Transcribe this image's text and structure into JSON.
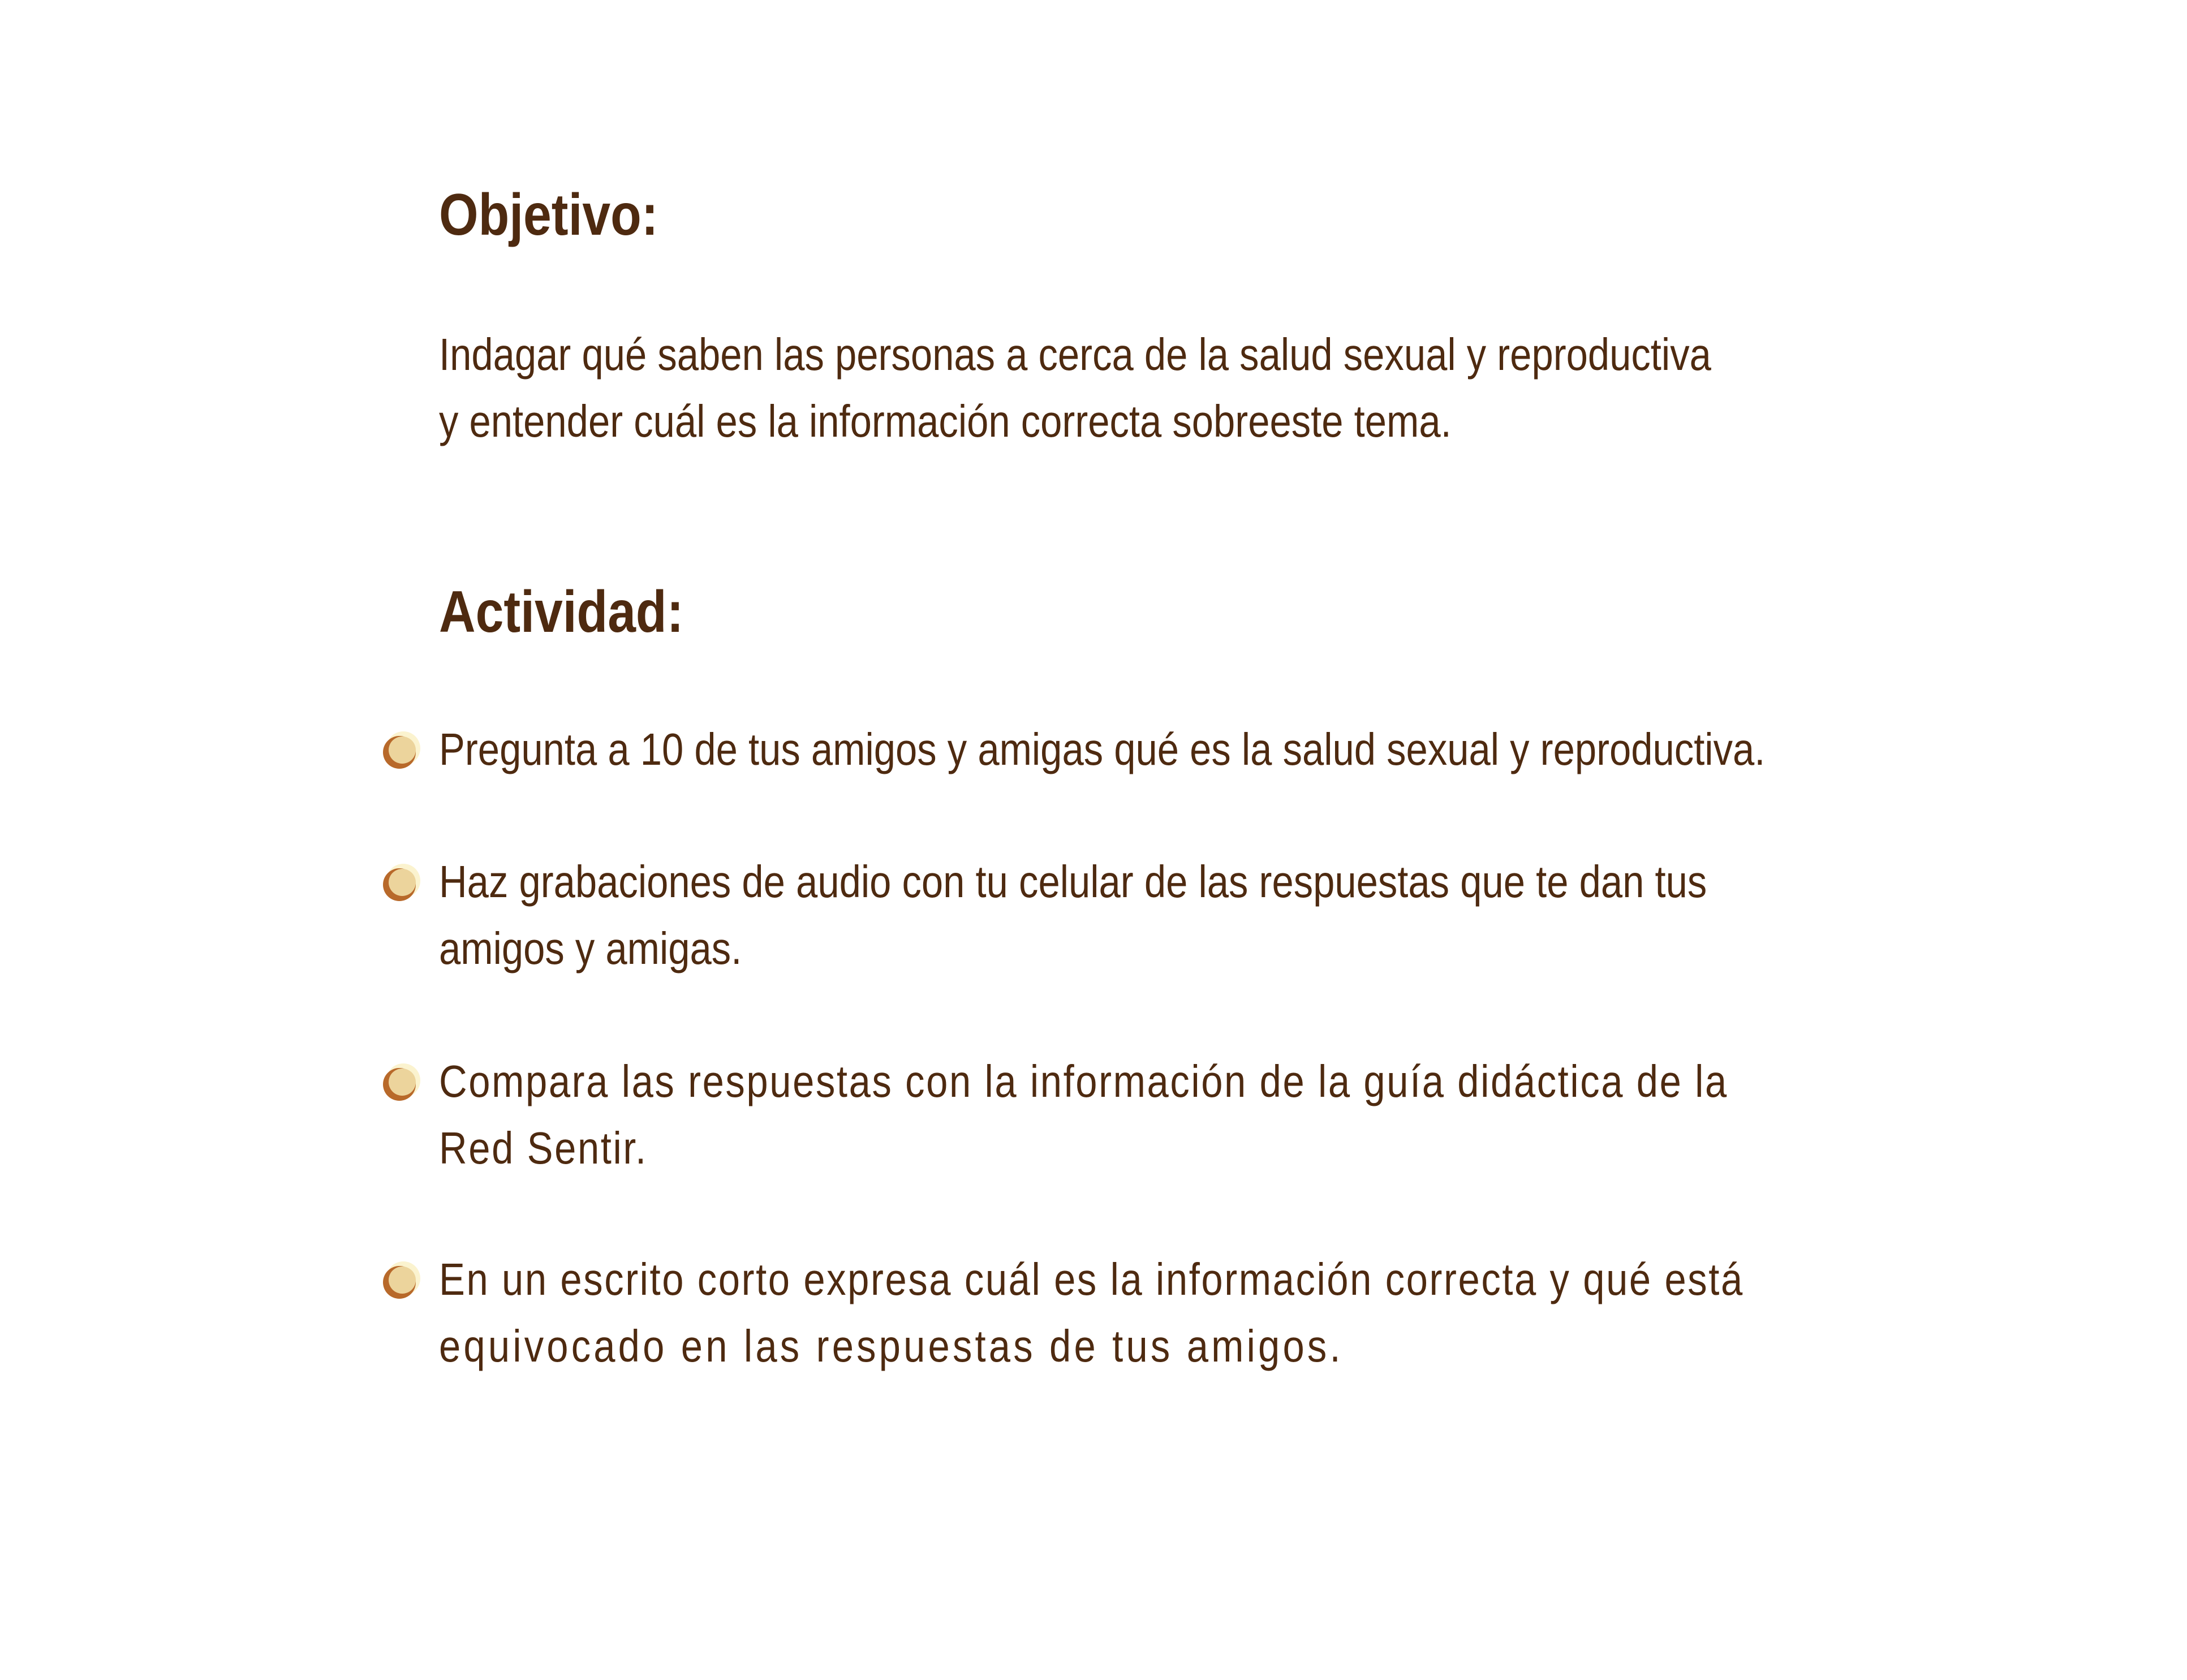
{
  "objetivo": {
    "heading": "Objetivo:",
    "lines": [
      "Indagar qué saben las personas a cerca de la salud sexual y reproductiva",
      "y entender cuál es la información correcta sobreeste tema."
    ]
  },
  "actividad": {
    "heading": "Actividad:",
    "items": [
      {
        "icon": "bullet-circle-icon",
        "lines": [
          "Pregunta a 10 de tus amigos y amigas qué es la salud sexual y reproductiva."
        ]
      },
      {
        "icon": "bullet-circle-icon",
        "lines": [
          "Haz grabaciones de audio con tu celular de las respuestas que te dan tus",
          "amigos y amigas."
        ]
      },
      {
        "icon": "bullet-circle-icon",
        "lines": [
          "Compara las respuestas con  la información de la guía didáctica  de la",
          "Red Sentir."
        ]
      },
      {
        "icon": "bullet-circle-icon",
        "lines": [
          "En un escrito corto expresa cuál es la información correcta y  qué está",
          "equivocado en las respuestas de tus amigos."
        ]
      }
    ]
  },
  "colors": {
    "text": "#4e2a10",
    "bullet_outer": "#b8692a",
    "bullet_inner": "#ecd49c",
    "bullet_glow": "#fbf3cf"
  }
}
